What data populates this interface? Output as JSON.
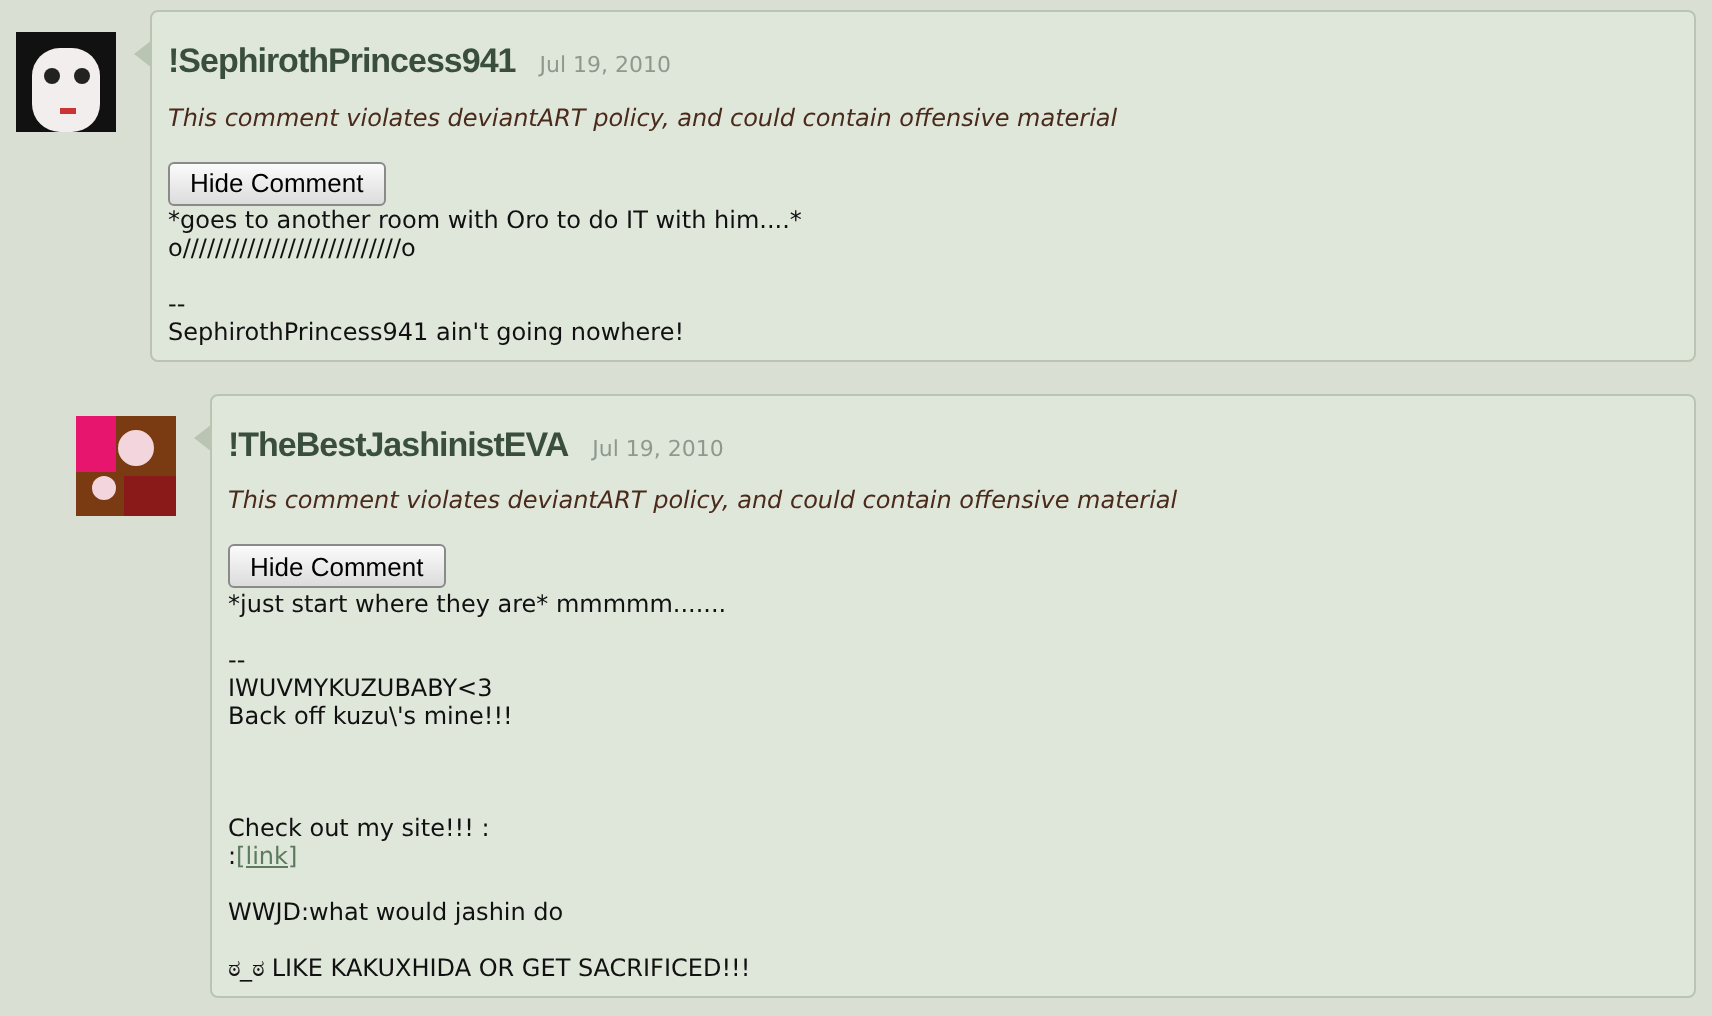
{
  "comments": [
    {
      "username": "!SephirothPrincess941",
      "date": "Jul 19, 2010",
      "warning": "This comment violates deviantART policy, and could contain offensive material",
      "button": "Hide Comment",
      "body": [
        {
          "kind": "text",
          "text": "*goes to another room with Oro to do IT with him....*"
        },
        {
          "kind": "text",
          "text": "o///////////////////////////o"
        },
        {
          "kind": "gap"
        },
        {
          "kind": "text",
          "text": "--"
        },
        {
          "kind": "text",
          "text": "SephirothPrincess941 ain't going nowhere!"
        }
      ],
      "children": [
        {
          "username": "!TheBestJashinistEVA",
          "date": "Jul 19, 2010",
          "warning": "This comment violates deviantART policy, and could contain offensive material",
          "button": "Hide Comment",
          "body": [
            {
              "kind": "text",
              "text": "*just start where they are* mmmmm......."
            },
            {
              "kind": "gap"
            },
            {
              "kind": "text",
              "text": "--"
            },
            {
              "kind": "text",
              "text": "IWUVMYKUZUBABY<3"
            },
            {
              "kind": "text",
              "text": "Back off kuzu\\'s mine!!!"
            },
            {
              "kind": "gap"
            },
            {
              "kind": "gap"
            },
            {
              "kind": "gap"
            },
            {
              "kind": "text",
              "text": "Check out my site!!! :"
            },
            {
              "kind": "link",
              "prefix": ":",
              "text": "[link]"
            },
            {
              "kind": "gap"
            },
            {
              "kind": "text",
              "text": "WWJD:what would jashin do"
            },
            {
              "kind": "gap"
            },
            {
              "kind": "text",
              "text": "ಠ_ಠ LIKE KAKUXHIDA OR GET SACRIFICED!!!"
            }
          ]
        }
      ]
    }
  ]
}
